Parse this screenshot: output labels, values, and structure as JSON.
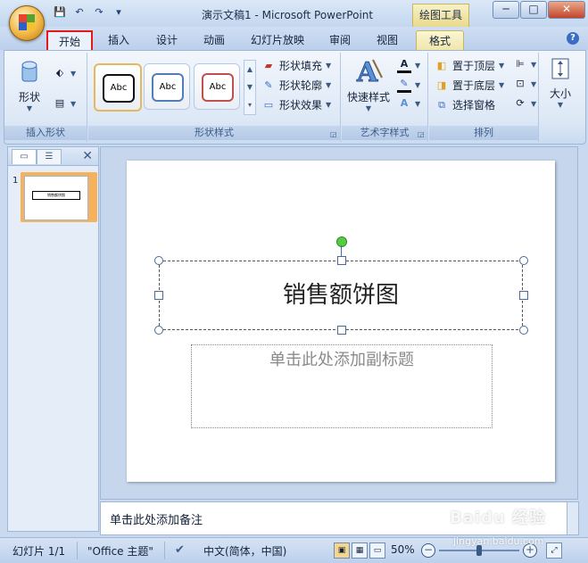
{
  "window": {
    "title": "演示文稿1 - Microsoft PowerPoint",
    "context_tool": "绘图工具",
    "min": "─",
    "max": "□",
    "close": "✕"
  },
  "quick_access": {
    "save": "💾",
    "undo": "↶",
    "redo": "↷",
    "more": "▾"
  },
  "tabs": [
    {
      "label": "开始",
      "highlighted": true
    },
    {
      "label": "插入"
    },
    {
      "label": "设计"
    },
    {
      "label": "动画"
    },
    {
      "label": "幻灯片放映"
    },
    {
      "label": "审阅"
    },
    {
      "label": "视图"
    },
    {
      "label": "格式",
      "active": true
    }
  ],
  "help": "?",
  "ribbon": {
    "insert_shape": {
      "label": "插入形状",
      "shape_button": "形状"
    },
    "shape_style": {
      "label": "形状样式",
      "styles": [
        {
          "text": "Abc",
          "border": "#111111"
        },
        {
          "text": "Abc",
          "border": "#4f7fb6"
        },
        {
          "text": "Abc",
          "border": "#c0504d"
        }
      ],
      "fill": "形状填充",
      "outline": "形状轮廓",
      "effect": "形状效果"
    },
    "wordart": {
      "label": "艺术字样式",
      "quick_style": "快速样式"
    },
    "arrange": {
      "label": "排列",
      "bring_front": "置于顶层",
      "send_back": "置于底层",
      "selection_pane": "选择窗格"
    },
    "size": {
      "label": "大小"
    }
  },
  "left_pane": {
    "close": "✕",
    "slide_number": "1",
    "thumb_title": "销售额饼图"
  },
  "slide": {
    "title": "销售额饼图",
    "subtitle_placeholder": "单击此处添加副标题"
  },
  "notes_placeholder": "单击此处添加备注",
  "status": {
    "slide_info": "幻灯片 1/1",
    "theme": "\"Office 主题\"",
    "language": "中文(简体，中国)",
    "zoom": "50%",
    "zoom_minus": "−",
    "zoom_plus": "+"
  },
  "watermark": {
    "brand": "Baidu 经验",
    "url": "jingyan.baidu.com"
  },
  "colors": {
    "highlight_border": "#e31a1a",
    "active_thumb": "#f5b25a",
    "accent": "#3a6cc4"
  }
}
